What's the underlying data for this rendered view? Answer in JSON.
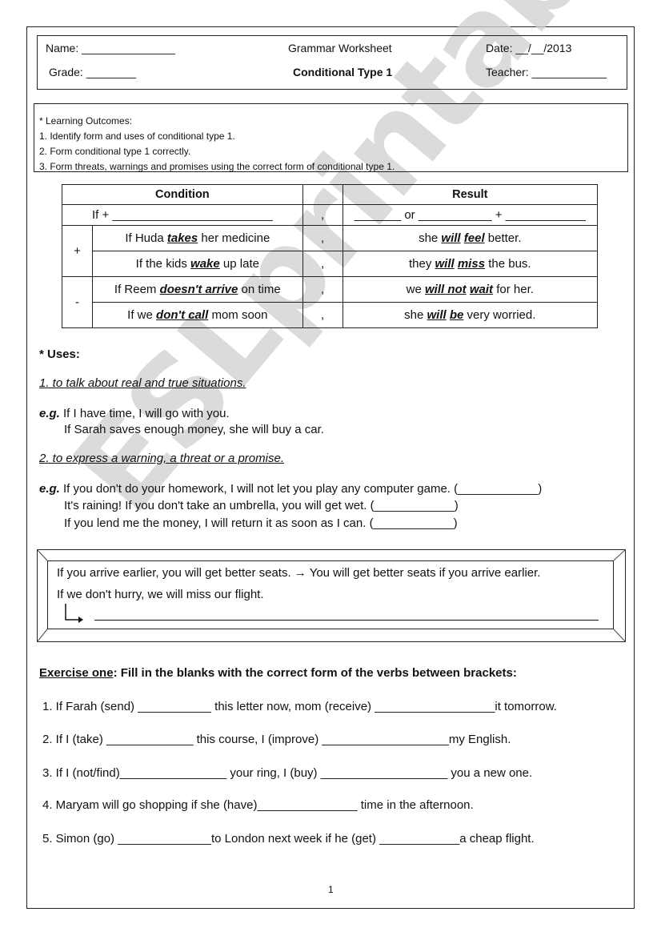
{
  "header": {
    "name_label": "Name: _______________",
    "title": "Grammar Worksheet",
    "date_label": "Date: __/__/2013",
    "grade_label": "Grade: ________",
    "subtitle": "Conditional Type 1",
    "teacher_label": "Teacher: ____________"
  },
  "learning_outcomes": {
    "heading": "* Learning Outcomes:",
    "items": [
      "1. Identify form  and uses of conditional type 1.",
      "2. Form conditional type 1 correctly.",
      "3. Form threats, warnings and promises using the correct form of conditional type 1."
    ]
  },
  "form_table": {
    "headers": [
      "Condition",
      "",
      "Result"
    ],
    "formula": {
      "condition": "If + ________________________",
      "comma": ",",
      "result": "_______ or ___________ + ____________"
    },
    "groups": [
      {
        "sign": "+",
        "rows": [
          {
            "c_pre": "If Huda ",
            "c_verb": "takes",
            "c_post": " her medicine",
            "comma": ",",
            "r_pre": "she ",
            "r_verb1": "will",
            "r_verb2": "feel",
            "r_post": " better."
          },
          {
            "c_pre": "If the kids ",
            "c_verb": "wake",
            "c_post": " up late",
            "comma": ",",
            "r_pre": "they ",
            "r_verb1": "will",
            "r_verb2": "miss",
            "r_post": " the bus."
          }
        ]
      },
      {
        "sign": "-",
        "rows": [
          {
            "c_pre": "If Reem ",
            "c_verb": "doesn't arrive",
            "c_post": " on time",
            "comma": ",",
            "r_pre": "we ",
            "r_verb1": "will not",
            "r_verb2": "wait",
            "r_post": " for her."
          },
          {
            "c_pre": "If we ",
            "c_verb": "don't call",
            "c_post": " mom soon",
            "comma": ",",
            "r_pre": "she ",
            "r_verb1": "will",
            "r_verb2": "be",
            "r_post": " very worried."
          }
        ]
      }
    ]
  },
  "uses": {
    "title": "* Uses:",
    "use1": "1. to talk about real and true situations.",
    "eg_label": "e.g.",
    "use1_examples": [
      "If I have time, I will go with you.",
      "If Sarah saves enough money, she will buy a car."
    ],
    "use2": "2. to express a warning, a threat or a promise.",
    "use2_examples": [
      "If you don't do your homework, I will not let you play any computer game. (____________)",
      "It's raining! If you don't take an umbrella, you will get wet. (____________)",
      "If you lend me the money, I will return it as soon as I can. (____________)"
    ]
  },
  "swap_box": {
    "line1": "If you arrive earlier, you will get better seats. → You will get better seats if you arrive earlier.",
    "line2": "If we don't hurry, we will miss our flight."
  },
  "exercise": {
    "title_underlined": "Exercise one",
    "title_rest": ": Fill in the blanks with the correct form of the verbs between brackets:",
    "items": [
      "1.  If Farah (send) ___________ this letter now, mom (receive)  __________________it tomorrow.",
      "2.  If I (take) _____________ this course, I (improve) ___________________my English.",
      "3.  If I (not/find)________________ your ring, I (buy) ___________________ you a new one.",
      "4.  Maryam will go shopping if she (have)_______________ time in the afternoon.",
      "5.  Simon (go) ______________to London next week if he (get) ____________a cheap flight."
    ]
  },
  "page_number": "1",
  "watermark": "ESLprintables.com"
}
